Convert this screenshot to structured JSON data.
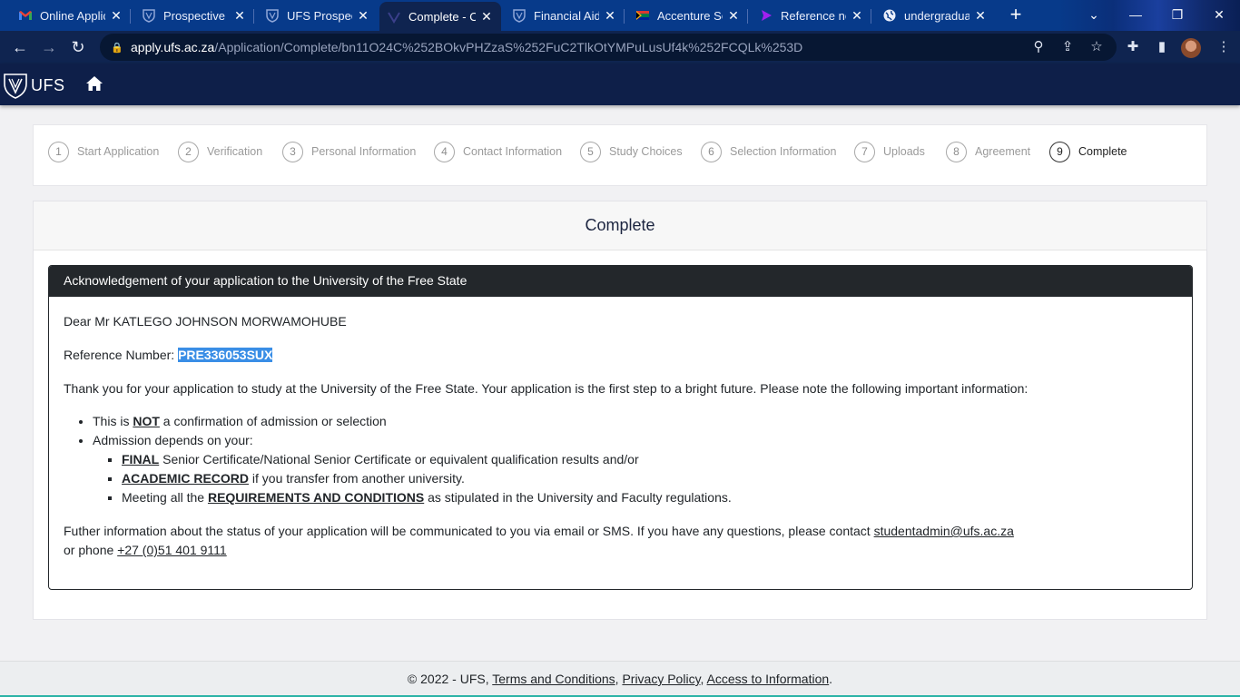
{
  "browser": {
    "tabs": [
      {
        "title": "Online Applic",
        "icon": "gmail-icon"
      },
      {
        "title": "Prospective S",
        "icon": "ufs-shield-icon"
      },
      {
        "title": "UFS Prospect",
        "icon": "ufs-shield-icon"
      },
      {
        "title": "Complete - O",
        "icon": "ufs-logo-icon"
      },
      {
        "title": "Financial Aid",
        "icon": "ufs-shield-icon"
      },
      {
        "title": "Accenture Sc",
        "icon": "flag-icon"
      },
      {
        "title": "Reference no",
        "icon": "play-arrow-icon"
      },
      {
        "title": "undergraduat",
        "icon": "globe-icon"
      }
    ],
    "active_tab_index": 3,
    "url_host": "apply.ufs.ac.za",
    "url_path": "/Application/Complete/bn11O24C%252BOkvPHZzaS%252FuC2TlkOtYMPuLusUf4k%252FCQLk%253D",
    "accent_color": "#073a8a"
  },
  "site": {
    "logo_text": "UFS",
    "header_color": "#0e1f49"
  },
  "stepper": {
    "steps": [
      {
        "num": "1",
        "label": "Start Application"
      },
      {
        "num": "2",
        "label": "Verification"
      },
      {
        "num": "3",
        "label": "Personal Information"
      },
      {
        "num": "4",
        "label": "Contact Information"
      },
      {
        "num": "5",
        "label": "Study Choices"
      },
      {
        "num": "6",
        "label": "Selection Information"
      },
      {
        "num": "7",
        "label": "Uploads"
      },
      {
        "num": "8",
        "label": "Agreement"
      },
      {
        "num": "9",
        "label": "Complete"
      }
    ],
    "current_step": "9"
  },
  "card": {
    "title": "Complete"
  },
  "ack": {
    "heading": "Acknowledgement of your application to the University of the Free State",
    "greeting": "Dear Mr KATLEGO JOHNSON MORWAMOHUBE",
    "ref_label": "Reference Number: ",
    "ref_value": "PRE336053SUX",
    "intro": "Thank you for your application to study at the University of the Free State. Your application is the first step to a bright future. Please note the following important information:",
    "bullet1_pre": "This is ",
    "bullet1_strong": "NOT",
    "bullet1_post": " a confirmation of admission or selection",
    "bullet2": "Admission depends on your:",
    "sub1_strong": "FINAL",
    "sub1_post": " Senior Certificate/National Senior Certificate or equivalent qualification results and/or",
    "sub2_strong": "ACADEMIC RECORD",
    "sub2_post": " if you transfer from another university.",
    "sub3_pre": "Meeting all the ",
    "sub3_strong": "REQUIREMENTS AND CONDITIONS",
    "sub3_post": " as stipulated in the University and Faculty regulations.",
    "further_pre": "Futher information about the status of your application will be communicated to you via email or SMS. If you have any questions, please contact ",
    "email": "studentadmin@ufs.ac.za",
    "phone_pre": "or phone ",
    "phone": "+27 (0)51 401 9111"
  },
  "footer": {
    "copyright": "© 2022 - UFS, ",
    "terms": "Terms and Conditions",
    "sep1": ", ",
    "privacy": "Privacy Policy",
    "sep2": ", ",
    "access": "Access to Information",
    "end": "."
  }
}
